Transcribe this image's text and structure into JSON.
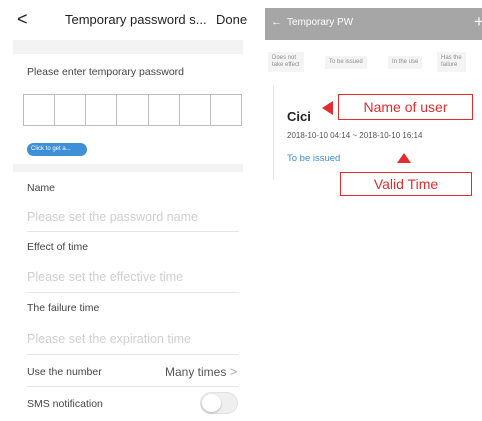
{
  "left_screen": {
    "header": {
      "back_icon": "chevron-left-icon",
      "back_glyph": "<",
      "title": "Temporary password s...",
      "done_label": "Done"
    },
    "password_prompt": "Please enter temporary password",
    "password_box_count": 8,
    "get_button_label": "Click to get a...",
    "form": {
      "name_label": "Name",
      "name_placeholder": "Please set the password name",
      "effect_label": "Effect of time",
      "effect_placeholder": "Please set the effective time",
      "failure_label": "The failure time",
      "failure_placeholder": "Please set the expiration time",
      "use_number_label": "Use the number",
      "use_number_value": "Many times",
      "use_number_chevron": ">",
      "sms_label": "SMS notification",
      "sms_enabled": false
    },
    "colors": {
      "accent": "#3e8fd8",
      "divider": "#e6e6e6"
    }
  },
  "right_screen": {
    "header": {
      "back_icon": "arrow-left-icon",
      "back_glyph": "←",
      "title": "Temporary PW",
      "add_icon": "plus-icon",
      "add_glyph": "+"
    },
    "tabs": [
      {
        "line1": "Does not",
        "line2": "take effect"
      },
      {
        "line1": "To be issued",
        "line2": ""
      },
      {
        "line1": "In the use",
        "line2": ""
      },
      {
        "line1": "Has the",
        "line2": "failure"
      }
    ],
    "card": {
      "user_name": "Cici",
      "time_range": "2018-10-10 04:14 ~ 2018-10-10 16:14",
      "status": "To be issued"
    },
    "annotations": {
      "name_callout": "Name of user",
      "time_callout": "Valid Time",
      "color": "#e12d2d"
    },
    "colors": {
      "header_bg": "#a6a6a6",
      "status": "#3e8fd8"
    }
  }
}
